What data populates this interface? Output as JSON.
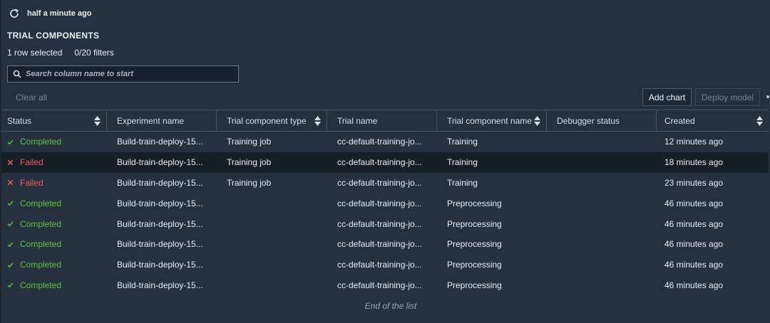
{
  "header": {
    "refresh_text": "half a minute ago",
    "title": "TRIAL COMPONENTS",
    "row_selected": "1 row selected",
    "filters": "0/20 filters"
  },
  "search": {
    "placeholder": "Search column name to start"
  },
  "toolbar": {
    "clear_all": "Clear all",
    "add_chart": "Add chart",
    "deploy_model": "Deploy model"
  },
  "table": {
    "columns": [
      {
        "label": "Status",
        "sortable": true
      },
      {
        "label": "Experiment name",
        "sortable": false
      },
      {
        "label": "Trial component type",
        "sortable": true
      },
      {
        "label": "Trial name",
        "sortable": false
      },
      {
        "label": "Trial component name",
        "sortable": true
      },
      {
        "label": "Debugger status",
        "sortable": false
      },
      {
        "label": "Created",
        "sortable": true
      }
    ],
    "rows": [
      {
        "status": "Completed",
        "experiment": "Build-train-deploy-15...",
        "type": "Training job",
        "trial": "cc-default-training-jo...",
        "component": "Training",
        "debugger": "",
        "created": "12 minutes ago"
      },
      {
        "status": "Failed",
        "experiment": "Build-train-deploy-15...",
        "type": "Training job",
        "trial": "cc-default-training-jo...",
        "component": "Training",
        "debugger": "",
        "created": "18 minutes ago"
      },
      {
        "status": "Failed",
        "experiment": "Build-train-deploy-15...",
        "type": "Training job",
        "trial": "cc-default-training-jo...",
        "component": "Training",
        "debugger": "",
        "created": "23 minutes ago"
      },
      {
        "status": "Completed",
        "experiment": "Build-train-deploy-15...",
        "type": "",
        "trial": "cc-default-training-jo...",
        "component": "Preprocessing",
        "debugger": "",
        "created": "46 minutes ago"
      },
      {
        "status": "Completed",
        "experiment": "Build-train-deploy-15...",
        "type": "",
        "trial": "cc-default-training-jo...",
        "component": "Preprocessing",
        "debugger": "",
        "created": "46 minutes ago"
      },
      {
        "status": "Completed",
        "experiment": "Build-train-deploy-15...",
        "type": "",
        "trial": "cc-default-training-jo...",
        "component": "Preprocessing",
        "debugger": "",
        "created": "46 minutes ago"
      },
      {
        "status": "Completed",
        "experiment": "Build-train-deploy-15...",
        "type": "",
        "trial": "cc-default-training-jo...",
        "component": "Preprocessing",
        "debugger": "",
        "created": "46 minutes ago"
      },
      {
        "status": "Completed",
        "experiment": "Build-train-deploy-15...",
        "type": "",
        "trial": "cc-default-training-jo...",
        "component": "Preprocessing",
        "debugger": "",
        "created": "46 minutes ago"
      }
    ],
    "end_text": "End of the list"
  },
  "colors": {
    "background": "#263140",
    "selected_row": "#161e28",
    "completed": "#5ec242",
    "failed": "#f45c5c"
  },
  "icons": {
    "refresh": "refresh-icon",
    "search": "search-icon",
    "sort": "sort-icon",
    "completed": "check-icon",
    "failed": "x-icon"
  }
}
